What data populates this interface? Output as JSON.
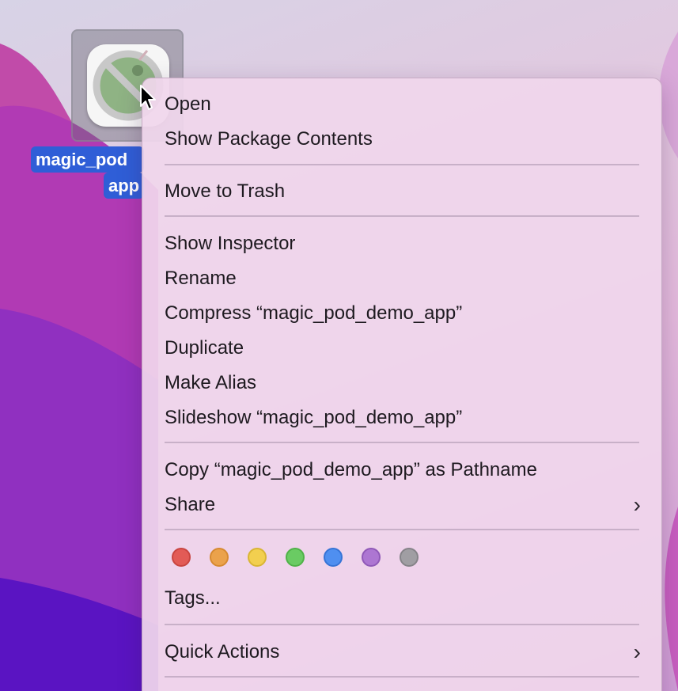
{
  "desktop": {
    "icon_label_line1": "magic_pod",
    "icon_label_line2": "app",
    "app_icon": "app-blocked-icon"
  },
  "menu": {
    "items": [
      {
        "label": "Open"
      },
      {
        "label": "Show Package Contents"
      },
      {
        "label": "Move to Trash"
      },
      {
        "label": "Show Inspector"
      },
      {
        "label": "Rename"
      },
      {
        "label": "Compress “magic_pod_demo_app”"
      },
      {
        "label": "Duplicate"
      },
      {
        "label": "Make Alias"
      },
      {
        "label": "Slideshow “magic_pod_demo_app”"
      },
      {
        "label": "Copy “magic_pod_demo_app” as Pathname"
      },
      {
        "label": "Share",
        "submenu": true
      },
      {
        "label": "Tags..."
      },
      {
        "label": "Quick Actions",
        "submenu": true
      }
    ],
    "tag_colors": [
      {
        "name": "red",
        "fill": "#e25b56",
        "stroke": "#c94540"
      },
      {
        "name": "orange",
        "fill": "#eba24b",
        "stroke": "#d78a30"
      },
      {
        "name": "yellow",
        "fill": "#f2cf4f",
        "stroke": "#d9b534"
      },
      {
        "name": "green",
        "fill": "#6acb63",
        "stroke": "#4fb248"
      },
      {
        "name": "blue",
        "fill": "#4f8ff0",
        "stroke": "#3674d6"
      },
      {
        "name": "purple",
        "fill": "#ad76d2",
        "stroke": "#9059b8"
      },
      {
        "name": "gray",
        "fill": "#a09ea3",
        "stroke": "#858388"
      }
    ],
    "chevron": "›"
  },
  "colors": {
    "selection": "#2f5ed7",
    "menu_background": "#f0d6ec"
  }
}
